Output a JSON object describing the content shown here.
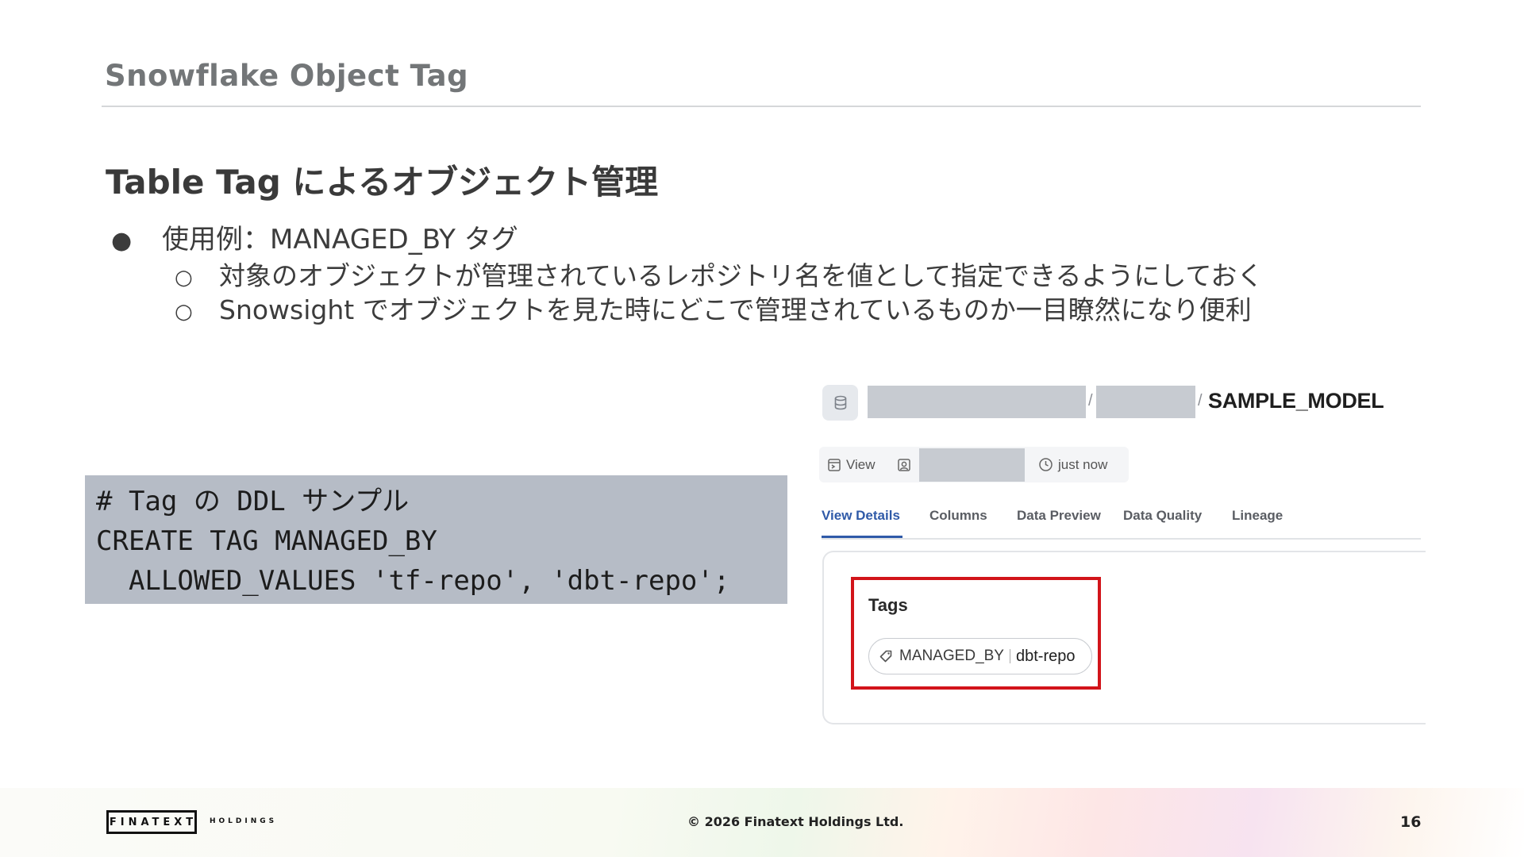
{
  "header": {
    "title": "Snowflake Object Tag"
  },
  "slide": {
    "title": "Table Tag によるオブジェクト管理",
    "bullets": [
      {
        "mark": "●",
        "text": "使用例：MANAGED_BY タグ"
      },
      {
        "mark": "○",
        "text": "対象のオブジェクトが管理されているレポジトリ名を値として指定できるようにしておく"
      },
      {
        "mark": "○",
        "text": "Snowsight でオブジェクトを見た時にどこで管理されているものか一目瞭然になり便利"
      }
    ]
  },
  "code": {
    "lines": [
      "# Tag の DDL サンプル",
      "CREATE TAG MANAGED_BY",
      "  ALLOWED_VALUES 'tf-repo', 'dbt-repo';"
    ]
  },
  "screenshot": {
    "breadcrumb_separator": "/",
    "object_name": "SAMPLE_MODEL",
    "meta": {
      "type_label": "View",
      "updated": "just now"
    },
    "tabs": [
      "View Details",
      "Columns",
      "Data Preview",
      "Data Quality",
      "Lineage"
    ],
    "active_tab": "View Details",
    "tags_heading": "Tags",
    "tag": {
      "key": "MANAGED_BY",
      "value": "dbt-repo"
    },
    "colors": {
      "accent": "#2f5aa8",
      "highlight": "#d2141a"
    }
  },
  "footer": {
    "logo": "FINATEXT",
    "logo_sub": "HOLDINGS",
    "copyright": "© 2026 Finatext Holdings Ltd.",
    "page": "16"
  }
}
